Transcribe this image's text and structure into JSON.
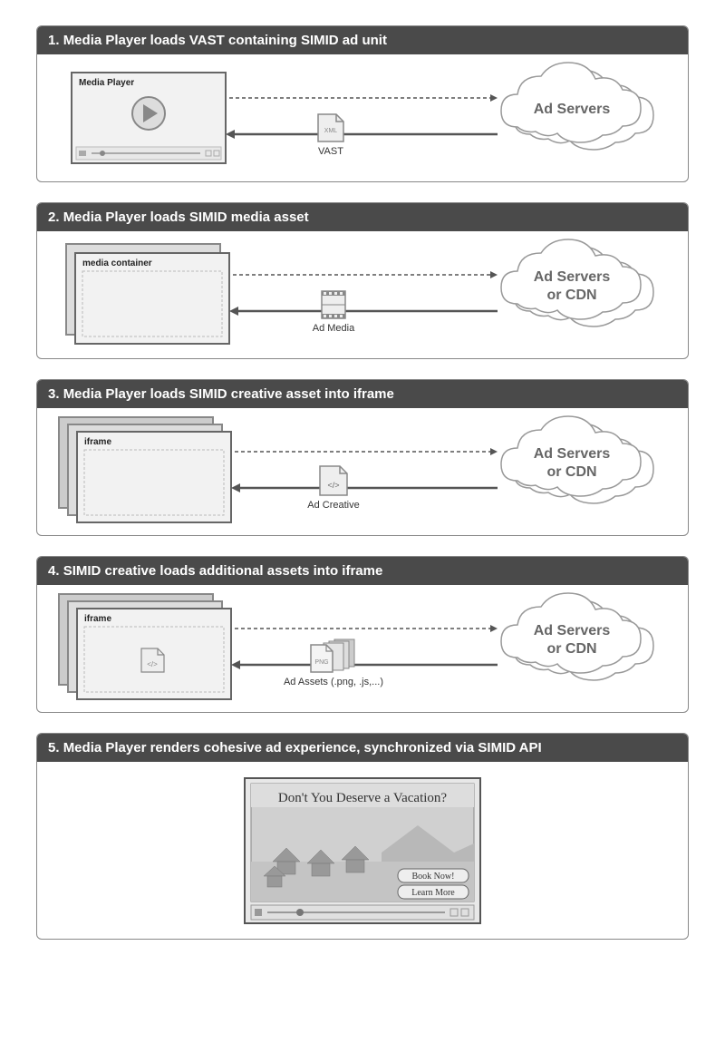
{
  "steps": [
    {
      "number": "1.",
      "title": "Media Player loads VAST containing SIMID ad unit",
      "left_label": "Media Player",
      "mid_icon_text": "XML",
      "mid_label": "VAST",
      "cloud_line1": "Ad Servers",
      "cloud_line2": ""
    },
    {
      "number": "2.",
      "title": "Media Player loads SIMID media asset",
      "left_label": "media container",
      "mid_icon_text": "",
      "mid_label": "Ad Media",
      "cloud_line1": "Ad Servers",
      "cloud_line2": "or CDN"
    },
    {
      "number": "3.",
      "title": "Media Player loads SIMID creative asset into iframe",
      "left_label": "iframe",
      "mid_icon_text": "</>",
      "mid_label": "Ad Creative",
      "cloud_line1": "Ad Servers",
      "cloud_line2": "or CDN"
    },
    {
      "number": "4.",
      "title": "SIMID creative loads additional assets into iframe",
      "left_label": "iframe",
      "mid_icon_text": "PNG",
      "mid_label": "Ad Assets (.png, .js,...)",
      "cloud_line1": "Ad Servers",
      "cloud_line2": "or CDN"
    },
    {
      "number": "5.",
      "title": "Media Player renders cohesive ad experience, synchronized via SIMID API",
      "ad_headline": "Don't You Deserve a Vacation?",
      "ad_btn1": "Book Now!",
      "ad_btn2": "Learn More"
    }
  ]
}
